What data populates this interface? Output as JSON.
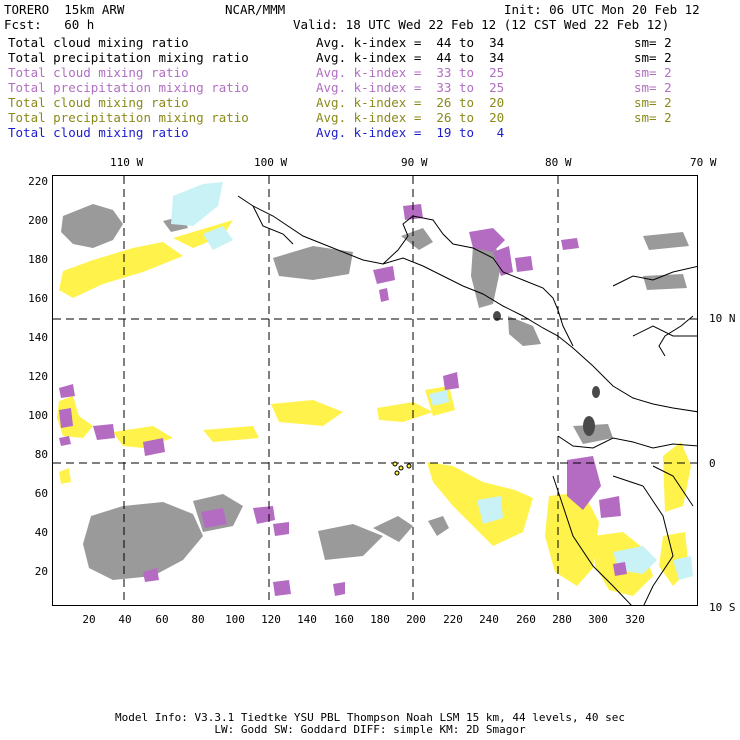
{
  "header": {
    "model": "TORERO  15km ARW",
    "org": "NCAR/MMM",
    "init": "Init: 06 UTC Mon 20 Feb 12",
    "fcst": "Fcst:   60 h",
    "valid": "Valid: 18 UTC Wed 22 Feb 12 (12 CST Wed 22 Feb 12)"
  },
  "legend": [
    {
      "field": "Total cloud mixing ratio",
      "kindex": "Avg. k-index =  44 to  34",
      "sm": "sm= 2",
      "color": "#000000"
    },
    {
      "field": "Total precipitation mixing ratio",
      "kindex": "Avg. k-index =  44 to  34",
      "sm": "sm= 2",
      "color": "#000000"
    },
    {
      "field": "Total cloud mixing ratio",
      "kindex": "Avg. k-index =  33 to  25",
      "sm": "sm= 2",
      "color": "#b16fc1"
    },
    {
      "field": "Total precipitation mixing ratio",
      "kindex": "Avg. k-index =  33 to  25",
      "sm": "sm= 2",
      "color": "#b16fc1"
    },
    {
      "field": "Total cloud mixing ratio",
      "kindex": "Avg. k-index =  26 to  20",
      "sm": "sm= 2",
      "color": "#8a8a1a"
    },
    {
      "field": "Total precipitation mixing ratio",
      "kindex": "Avg. k-index =  26 to  20",
      "sm": "sm= 2",
      "color": "#8a8a1a"
    },
    {
      "field": "Total cloud mixing ratio",
      "kindex": "Avg. k-index =  19 to   4",
      "sm": "",
      "color": "#1c1ccf"
    }
  ],
  "top_lon_labels": [
    "110 W",
    "100 W",
    "90 W",
    "80 W",
    "70 W"
  ],
  "right_lat_labels": [
    "10 N",
    "0",
    "10 S"
  ],
  "y_ticks": [
    "220",
    "200",
    "180",
    "160",
    "140",
    "120",
    "100",
    "80",
    "60",
    "40",
    "20"
  ],
  "x_ticks": [
    "20",
    "40",
    "60",
    "80",
    "100",
    "120",
    "140",
    "160",
    "180",
    "200",
    "220",
    "240",
    "260",
    "280",
    "300",
    "320"
  ],
  "footer": {
    "line1": "Model Info: V3.3.1   Tiedtke YSU PBL  Thompson    Noah LSM  15 km,   44 levels,   40 sec",
    "line2": "LW: Godd SW: Goddard DIFF: simple KM: 2D Smagor"
  },
  "colors": {
    "gray": "#9a9a9a",
    "purple": "#b46cc2",
    "yellow": "#fff24a",
    "cyan": "#c8f2f6",
    "dark": "#4a4a4a"
  }
}
